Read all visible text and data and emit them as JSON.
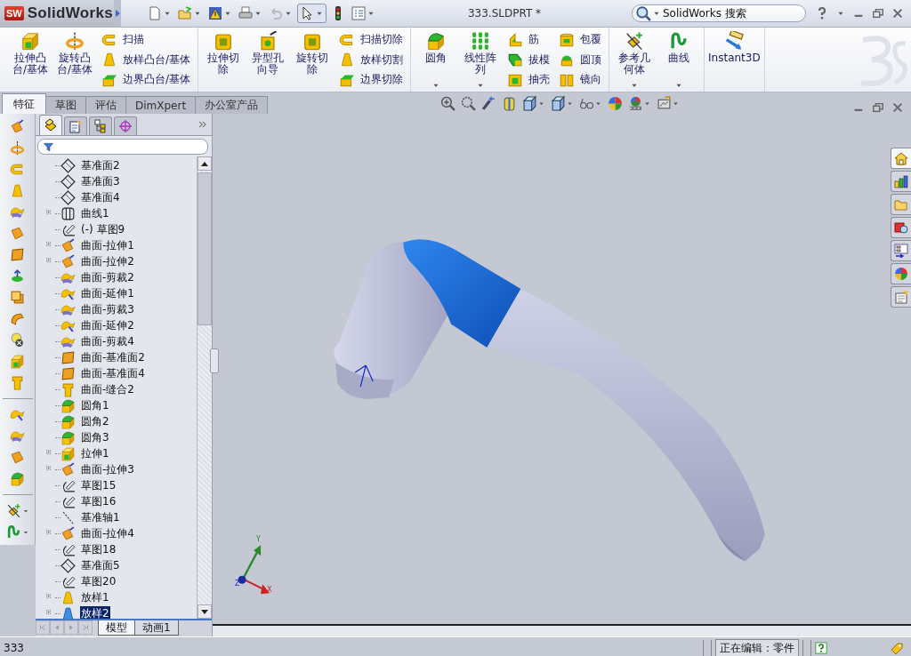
{
  "app": {
    "badge": "SW",
    "name": "SolidWorks"
  },
  "document_title": "333.SLDPRT *",
  "search": {
    "placeholder": "SolidWorks 搜索"
  },
  "ribbon": [
    {
      "items": [
        {
          "kind": "large",
          "label": "拉伸凸台/基体",
          "dropdown": false
        },
        {
          "kind": "large",
          "label": "旋转凸台/基体",
          "dropdown": false
        },
        {
          "kind": "stack",
          "items": [
            "扫描",
            "放样凸台/基体",
            "边界凸台/基体"
          ]
        }
      ]
    },
    {
      "items": [
        {
          "kind": "large",
          "label": "拉伸切除",
          "dropdown": false
        },
        {
          "kind": "large",
          "label": "异型孔向导",
          "dropdown": false
        },
        {
          "kind": "large",
          "label": "旋转切除",
          "dropdown": false
        },
        {
          "kind": "stack",
          "items": [
            "扫描切除",
            "放样切割",
            "边界切除"
          ]
        }
      ]
    },
    {
      "items": [
        {
          "kind": "large",
          "label": "圆角",
          "dropdown": true
        },
        {
          "kind": "large",
          "label": "线性阵列",
          "dropdown": true
        },
        {
          "kind": "stack",
          "items": [
            "筋",
            "拔模",
            "抽壳"
          ]
        },
        {
          "kind": "stack",
          "items": [
            "包覆",
            "圆顶",
            "镜向"
          ]
        }
      ]
    },
    {
      "items": [
        {
          "kind": "large",
          "label": "参考几何体",
          "dropdown": true
        },
        {
          "kind": "large",
          "label": "曲线",
          "dropdown": true
        }
      ]
    },
    {
      "items": [
        {
          "kind": "large",
          "label": "Instant3D",
          "dropdown": false
        }
      ]
    }
  ],
  "command_tabs": [
    {
      "label": "特征",
      "selected": true
    },
    {
      "label": "草图",
      "selected": false
    },
    {
      "label": "评估",
      "selected": false
    },
    {
      "label": "DimXpert",
      "selected": false
    },
    {
      "label": "办公室产品",
      "selected": false
    }
  ],
  "panel_tabs": [
    {
      "selected": true
    },
    {
      "selected": false
    },
    {
      "selected": false
    },
    {
      "selected": false
    }
  ],
  "feature_tree": [
    {
      "kind": "plane",
      "label": "基准面2",
      "expandable": false,
      "selected": false
    },
    {
      "kind": "plane",
      "label": "基准面3",
      "expandable": false,
      "selected": false
    },
    {
      "kind": "plane",
      "label": "基准面4",
      "expandable": false,
      "selected": false
    },
    {
      "kind": "curve",
      "label": "曲线1",
      "expandable": true,
      "selected": false
    },
    {
      "kind": "sketch",
      "label": "(-) 草图9",
      "expandable": false,
      "selected": false
    },
    {
      "kind": "surface-extrude",
      "label": "曲面-拉伸1",
      "expandable": true,
      "selected": false
    },
    {
      "kind": "surface-extrude",
      "label": "曲面-拉伸2",
      "expandable": true,
      "selected": false
    },
    {
      "kind": "surface-trim",
      "label": "曲面-剪裁2",
      "expandable": false,
      "selected": false
    },
    {
      "kind": "surface-extend",
      "label": "曲面-延伸1",
      "expandable": false,
      "selected": false
    },
    {
      "kind": "surface-trim",
      "label": "曲面-剪裁3",
      "expandable": false,
      "selected": false
    },
    {
      "kind": "surface-extend",
      "label": "曲面-延伸2",
      "expandable": false,
      "selected": false
    },
    {
      "kind": "surface-trim",
      "label": "曲面-剪裁4",
      "expandable": false,
      "selected": false
    },
    {
      "kind": "surface-planar",
      "label": "曲面-基准面2",
      "expandable": false,
      "selected": false
    },
    {
      "kind": "surface-planar",
      "label": "曲面-基准面4",
      "expandable": false,
      "selected": false
    },
    {
      "kind": "knit",
      "label": "曲面-缝合2",
      "expandable": false,
      "selected": false
    },
    {
      "kind": "fillet",
      "label": "圆角1",
      "expandable": false,
      "selected": false
    },
    {
      "kind": "fillet",
      "label": "圆角2",
      "expandable": false,
      "selected": false
    },
    {
      "kind": "fillet",
      "label": "圆角3",
      "expandable": false,
      "selected": false
    },
    {
      "kind": "extrude",
      "label": "拉伸1",
      "expandable": true,
      "selected": false
    },
    {
      "kind": "surface-extrude",
      "label": "曲面-拉伸3",
      "expandable": true,
      "selected": false
    },
    {
      "kind": "sketch",
      "label": "草图15",
      "expandable": false,
      "selected": false
    },
    {
      "kind": "sketch",
      "label": "草图16",
      "expandable": false,
      "selected": false
    },
    {
      "kind": "axis",
      "label": "基准轴1",
      "expandable": false,
      "selected": false
    },
    {
      "kind": "surface-extrude",
      "label": "曲面-拉伸4",
      "expandable": true,
      "selected": false
    },
    {
      "kind": "sketch",
      "label": "草图18",
      "expandable": false,
      "selected": false
    },
    {
      "kind": "plane",
      "label": "基准面5",
      "expandable": false,
      "selected": false
    },
    {
      "kind": "sketch",
      "label": "草图20",
      "expandable": false,
      "selected": false
    },
    {
      "kind": "loft",
      "label": "放样1",
      "expandable": true,
      "selected": false
    },
    {
      "kind": "loft",
      "label": "放样2",
      "expandable": true,
      "selected": true
    }
  ],
  "tree_bottom_tabs": [
    {
      "label": "模型",
      "selected": true
    },
    {
      "label": "动画1",
      "selected": false
    }
  ],
  "triad": {
    "x": "X",
    "y": "Y",
    "z": "Z"
  },
  "task_pane": [
    {
      "selected": true
    },
    {
      "selected": false
    },
    {
      "selected": false
    },
    {
      "selected": false
    },
    {
      "selected": false
    },
    {
      "selected": false
    },
    {
      "selected": false
    }
  ],
  "status_bar": {
    "message": "333",
    "mode": "正在编辑：零件"
  }
}
